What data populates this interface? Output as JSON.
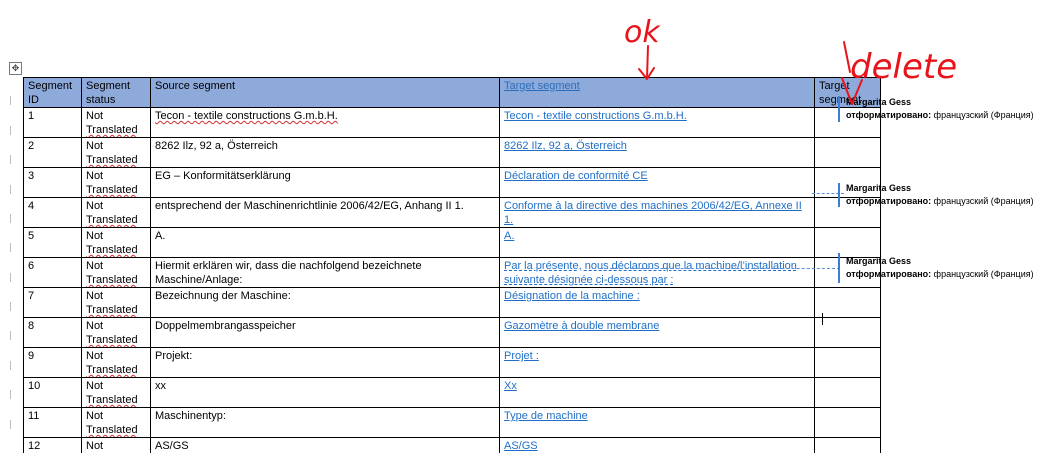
{
  "table": {
    "headers": [
      "Segment ID",
      "Segment status",
      "Source segment",
      "Target segment",
      "Target segment"
    ],
    "rows": [
      {
        "id": "1",
        "status": "Not Translated",
        "source": "Tecon - textile constructions G.m.b.H.",
        "target": "Tecon - textile constructions G.m.b.H."
      },
      {
        "id": "2",
        "status": "Not Translated",
        "source": "8262 Ilz, 92 a, Österreich",
        "target": "8262 Ilz, 92 a, Österreich"
      },
      {
        "id": "3",
        "status": "Not Translated",
        "source": "EG – Konformitätserklärung",
        "target": "Déclaration de conformité CE"
      },
      {
        "id": "4",
        "status": "Not Translated",
        "source": "entsprechend der Maschinenrichtlinie 2006/42/EG, Anhang II 1.",
        "target": "Conforme à la directive des machines 2006/42/EG, Annexe II 1."
      },
      {
        "id": "5",
        "status": "Not Translated",
        "source": "A.",
        "target": "A."
      },
      {
        "id": "6",
        "status": "Not Translated",
        "source": "Hiermit erklären wir, dass die nachfolgend bezeichnete Maschine/Anlage:",
        "target": "Par la présente, nous déclarons que la machine/l’installation suivante désignée ci-dessous par :"
      },
      {
        "id": "7",
        "status": "Not Translated",
        "source": "Bezeichnung der Maschine:",
        "target": "Désignation de la machine :"
      },
      {
        "id": "8",
        "status": "Not Translated",
        "source": "Doppelmembrangasspeicher",
        "target": "Gazomètre à double membrane"
      },
      {
        "id": "9",
        "status": "Not Translated",
        "source": "Projekt:",
        "target": "Projet :"
      },
      {
        "id": "10",
        "status": "Not Translated",
        "source": "xx",
        "target": "Xx"
      },
      {
        "id": "11",
        "status": "Not Translated",
        "source": "Maschinentyp:",
        "target": "Type de machine"
      },
      {
        "id": "12",
        "status": "Not Translated",
        "source": "AS/GS",
        "target": "AS/GS"
      }
    ]
  },
  "comments": [
    {
      "author": "Margarita Gess",
      "action": "отформатировано:",
      "detail": "французский (Франция)"
    },
    {
      "author": "Margarita Gess",
      "action": "отформатировано:",
      "detail": "французский (Франция)"
    },
    {
      "author": "Margarita Gess",
      "action": "отформатировано:",
      "detail": "французский (Франция)"
    }
  ],
  "annotations": {
    "ok": "ok",
    "delete": "delete",
    "ink_color": "#e8141c"
  },
  "colors": {
    "header_bg": "#8eaadb",
    "target_link": "#1f6fc8",
    "revision_bar": "#3a7dd4"
  }
}
